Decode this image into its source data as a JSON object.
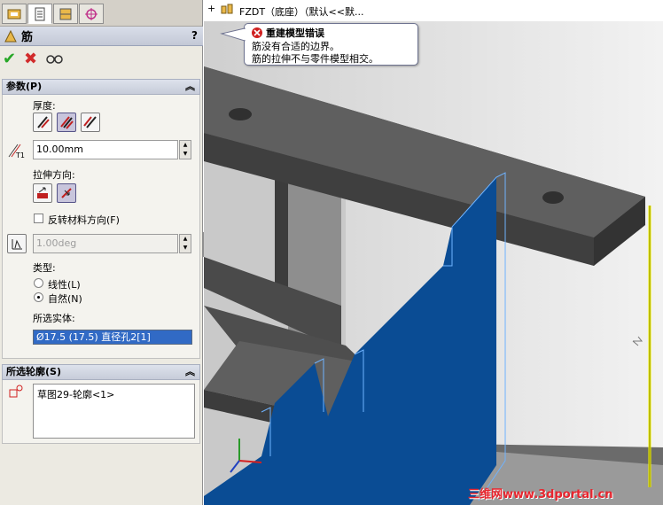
{
  "property_manager": {
    "feature_name": "筋",
    "help_label": "?",
    "params_group": {
      "header": "参数(P)",
      "thickness_label": "厚度:",
      "thickness_value": "10.00mm",
      "extrude_dir_label": "拉伸方向:",
      "flip_label": "反转材料方向(F)",
      "draft_value": "1.00deg",
      "type_label": "类型:",
      "type_options": [
        "线性(L)",
        "自然(N)"
      ],
      "type_selected": "自然(N)",
      "selected_body_label": "所选实体:",
      "selected_body_value": "Ø17.5 (17.5) 直径孔2[1]"
    },
    "profile_group": {
      "header": "所选轮廓(S)",
      "items": [
        "草图29-轮廓<1>"
      ]
    }
  },
  "viewport": {
    "tree_item": "FZDT（底座）（默认<<默...",
    "error_tooltip": {
      "title": "重建模型错误",
      "lines": [
        "筋没有合适的边界。",
        "筋的拉伸不与零件模型相交。"
      ]
    },
    "watermark": "三维网www.3dportal.cn"
  },
  "colors": {
    "rib_fill": "#0a4c94",
    "selection_blue": "#316ac5",
    "model_dark": "#575757",
    "highlight_edge": "#f4f400"
  }
}
